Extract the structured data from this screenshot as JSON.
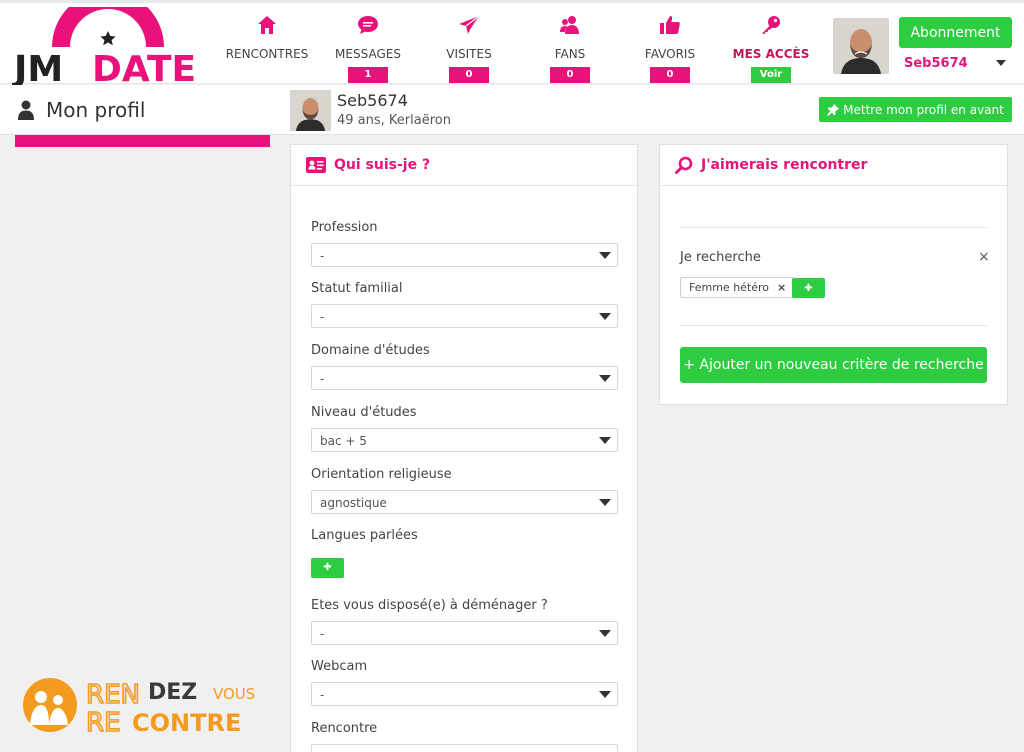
{
  "brand": {
    "logo_text_1": "JM",
    "logo_text_2": "DATE",
    "pink": "#e8127a",
    "green": "#2ecc40"
  },
  "nav": [
    {
      "label": "RENCONTRES",
      "icon": "home-icon",
      "badge": ""
    },
    {
      "label": "MESSAGES",
      "icon": "chat-bubble-icon",
      "badge": "1"
    },
    {
      "label": "VISITES",
      "icon": "paper-plane-icon",
      "badge": "0"
    },
    {
      "label": "FANS",
      "icon": "users-icon",
      "badge": "0"
    },
    {
      "label": "FAVORIS",
      "icon": "thumbs-up-icon",
      "badge": "0"
    },
    {
      "label": "MES ACCÈS",
      "icon": "key-icon",
      "badge": "Voir"
    }
  ],
  "header": {
    "subscribe_label": "Abonnement",
    "username": "Seb5674"
  },
  "subheader": {
    "page_title": "Mon profil",
    "profile_name": "Seb5674",
    "profile_meta": "49 ans, Kerlaëron",
    "boost_label": "Mettre mon profil en avant"
  },
  "about": {
    "title": "Qui suis-je ?",
    "fields": [
      {
        "label": "Profession",
        "value": "-"
      },
      {
        "label": "Statut familial",
        "value": "-"
      },
      {
        "label": "Domaine d'études",
        "value": "-"
      },
      {
        "label": "Niveau d'études",
        "value": "bac + 5"
      },
      {
        "label": "Orientation religieuse",
        "value": "agnostique"
      },
      {
        "label": "Langues parlées",
        "value": ""
      },
      {
        "label": "Etes vous disposé(e) à déménager ?",
        "value": "-"
      },
      {
        "label": "Webcam",
        "value": "-"
      },
      {
        "label": "Rencontre",
        "value": ""
      }
    ]
  },
  "seek": {
    "title": "J'aimerais rencontrer",
    "label": "Je recherche",
    "close": "×",
    "tag": "Femme hétéro",
    "tag_remove": "×",
    "new_criterion": "+ Ajouter un nouveau critère de recherche"
  },
  "watermark": {
    "part_1": "REN",
    "part_2": "DEZ",
    "part_3": "VOUS",
    "part_4": "CONTRE",
    "orange": "#f39b1f",
    "dark": "#3a3a3a"
  }
}
